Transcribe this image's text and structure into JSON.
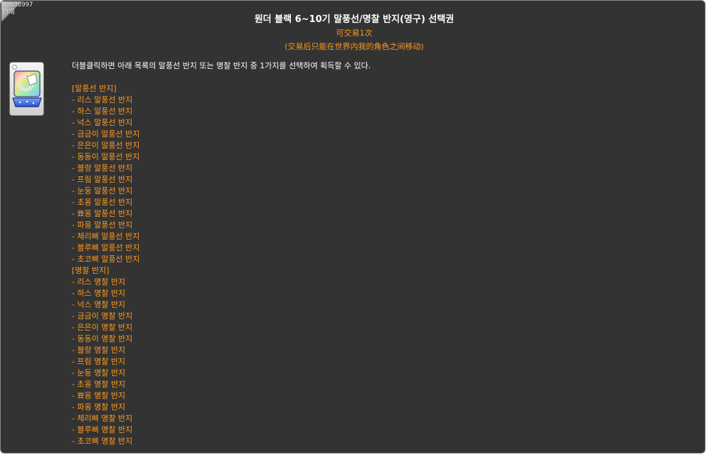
{
  "item": {
    "id_code": "02638997",
    "tag": "新增",
    "title": "원더 블랙 6~10기 말풍선/명찰 반지(영구) 선택권",
    "trade_info": "可交易1次",
    "trade_notice": "(交易后只能在世界内我的角色之间移动)",
    "icon": "ring-box-icon"
  },
  "description": "더블클릭하면 아래 목록의 말풍선 반지 또는 명찰 반지 중 1가지를 선택하여 획득할 수 있다.",
  "sections": [
    {
      "title": "[말풍선 반지]",
      "items": [
        "- 리스 말풍선 반지",
        "- 하스 말풍선 반지",
        "- 넉스 말풍선 반지",
        "- 금금이 말풍선 반지",
        "- 은은이 말풍선 반지",
        "- 동동이 말풍선 반지",
        "- 블랑 말풍선 반지",
        "- 프림 말풍선 반지",
        "- 눈둥 말풍선 반지",
        "- 초옹 말풍선 반지",
        "- 뾰옹 말풍선 반지",
        "- 파옹 말풍선 반지",
        "- 체리삐 말풍선 반지",
        "- 블루삐 말풍선 반지",
        "- 초코삐 말풍선 반지"
      ]
    },
    {
      "title": "[명찰 반지]",
      "items": [
        "- 리스 명찰 반지",
        "- 하스 명찰 반지",
        "- 넉스 명찰 반지",
        "- 금금이 명찰 반지",
        "- 은은이 명찰 반지",
        "- 동동이 명찰 반지",
        "- 블랑 명찰 반지",
        "- 프림 명찰 반지",
        "- 눈둥 명찰 반지",
        "- 초옹 명찰 반지",
        "- 뾰옹 명찰 반지",
        "- 파옹 명찰 반지",
        "- 체리삐 명찰 반지",
        "- 블루삐 명찰 반지",
        "- 초코삐 명찰 반지"
      ]
    }
  ],
  "colors": {
    "background": "#333333",
    "title": "#ffffff",
    "accent": "#ff9a1f"
  }
}
